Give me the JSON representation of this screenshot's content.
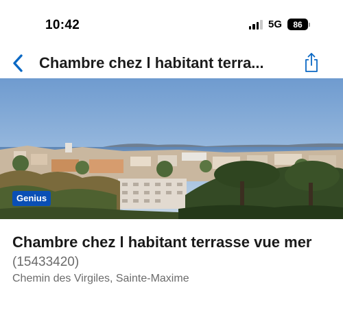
{
  "status_bar": {
    "time": "10:42",
    "network": "5G",
    "battery": "86"
  },
  "nav": {
    "back_icon": "chevron-left-icon",
    "title": "Chambre chez l habitant terra...",
    "share_icon": "share-icon",
    "accent_color": "#0a68c4"
  },
  "photo": {
    "badge": "Genius"
  },
  "listing": {
    "name": "Chambre chez l habitant terrasse vue mer",
    "id": "(15433420)",
    "address": "Chemin des Virgiles, Sainte-Maxime"
  }
}
